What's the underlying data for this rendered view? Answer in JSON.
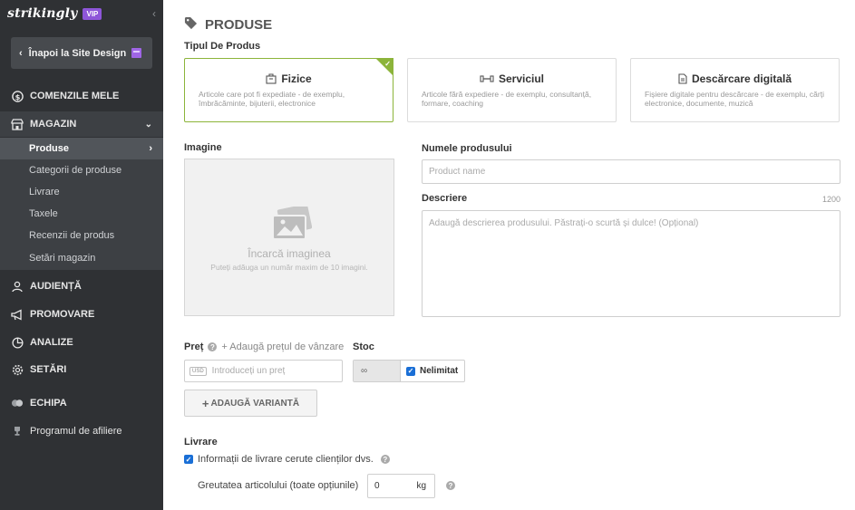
{
  "sidebar": {
    "brand": "strikingly",
    "vip": "VIP",
    "back_label": "Înapoi la Site Design",
    "nav": {
      "orders": "COMENZILE MELE",
      "store": "MAGAZIN",
      "audience": "AUDIENȚĂ",
      "promotion": "PROMOVARE",
      "analytics": "ANALIZE",
      "settings": "SETĂRI",
      "team": "ECHIPA",
      "affiliate": "Programul de afiliere"
    },
    "store_items": [
      "Produse",
      "Categorii de produse",
      "Livrare",
      "Taxele",
      "Recenzii de produs",
      "Setări magazin"
    ]
  },
  "main": {
    "title": "PRODUSE",
    "product_type_label": "Tipul De Produs",
    "types": [
      {
        "title": "Fizice",
        "desc": "Articole care pot fi expediate - de exemplu, îmbrăcăminte, bijuterii, electronice",
        "selected": true
      },
      {
        "title": "Serviciul",
        "desc": "Articole fără expediere - de exemplu, consultanță, formare, coaching",
        "selected": false
      },
      {
        "title": "Descărcare digitală",
        "desc": "Fișiere digitale pentru descărcare - de exemplu, cărți electronice, documente, muzică",
        "selected": false
      }
    ],
    "image_label": "Imagine",
    "upload_title": "Încarcă imaginea",
    "upload_sub": "Puteți adăuga un număr maxim de 10 imagini.",
    "name_label": "Numele produsului",
    "name_placeholder": "Product name",
    "desc_label": "Descriere",
    "desc_counter": "1200",
    "desc_placeholder": "Adaugă descrierea produsului. Păstrați-o scurtă și dulce! (Opțional)",
    "price_label": "Preț",
    "add_sale_price": "+ Adaugă prețul de vânzare",
    "currency": "USD",
    "price_placeholder": "Introduceți un preț",
    "stock_label": "Stoc",
    "stock_value": "∞",
    "unlimited": "Nelimitat",
    "add_variant": "ADAUGĂ VARIANTĂ",
    "shipping_label": "Livrare",
    "shipping_check": "Informații de livrare cerute clienților dvs.",
    "weight_label": "Greutatea articolului (toate opțiunile)",
    "weight_value": "0",
    "weight_unit": "kg"
  },
  "colors": {
    "sidebar_bg": "#2f3134",
    "accent_green": "#8cb43a",
    "vip_purple": "#8e56d9",
    "checkbox_blue": "#1a6fd6"
  }
}
